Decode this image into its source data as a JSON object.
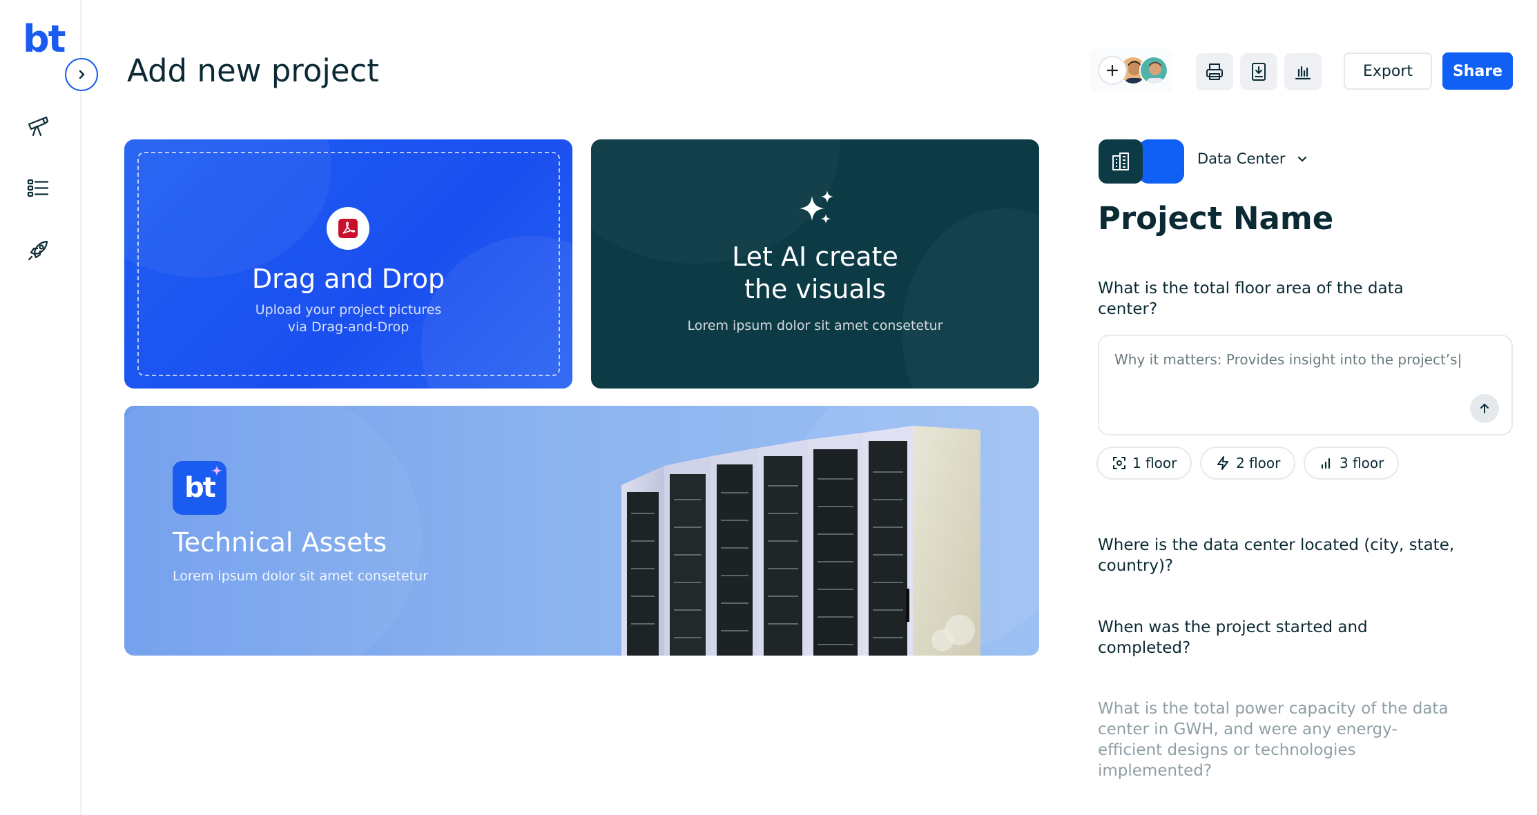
{
  "brand": {
    "logo_text": "bt",
    "accent": "#1a5cf0",
    "dark": "#0c3a45"
  },
  "sidebar": {
    "items": [
      {
        "icon": "telescope-icon"
      },
      {
        "icon": "checklist-icon"
      },
      {
        "icon": "rocket-icon"
      }
    ]
  },
  "header": {
    "title": "Add new project",
    "export_label": "Export",
    "share_label": "Share"
  },
  "cards": {
    "drop": {
      "title": "Drag and Drop",
      "subtitle_line1": "Upload your project pictures",
      "subtitle_line2": "via Drag-and-Drop"
    },
    "ai": {
      "title_line1": "Let AI create",
      "title_line2": "the visuals",
      "subtitle": "Lorem ipsum dolor sit amet consetetur"
    },
    "tech": {
      "badge": "bt",
      "title": "Technical Assets",
      "subtitle": "Lorem ipsum dolor sit amet consetetur"
    }
  },
  "panel": {
    "category": "Data Center",
    "project_name": "Project Name",
    "questions": [
      "What is the total floor area of the data center?",
      "Where is the data center located (city, state, country)?",
      "When was the project started and completed?",
      "What is the total power capacity of the data center in GWH, and were any energy-efficient designs or technologies implemented?"
    ],
    "answer_text": "Why it matters: Provides insight into the project’s|",
    "chips": [
      "1 floor",
      "2 floor",
      "3 floor"
    ]
  }
}
